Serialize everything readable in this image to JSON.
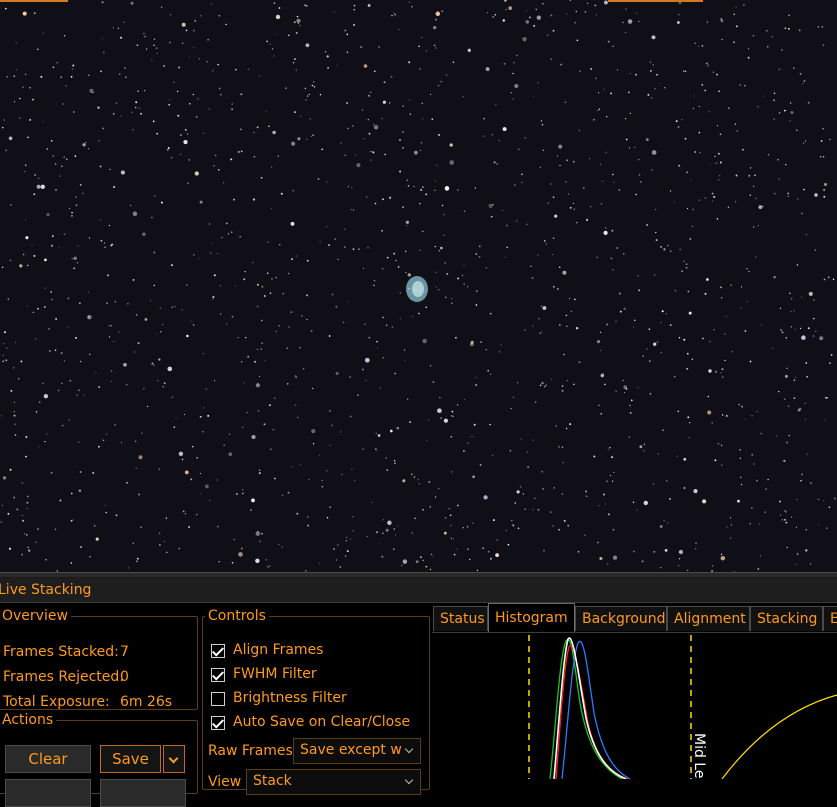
{
  "panel": {
    "title": "Live Stacking"
  },
  "overview": {
    "legend": "Overview",
    "frames_stacked_label": "Frames Stacked:",
    "frames_stacked_value": "7",
    "frames_rejected_label": "Frames Rejected:",
    "frames_rejected_value": "0",
    "total_exposure_label": "Total Exposure:",
    "total_exposure_value": "6m 26s"
  },
  "controls": {
    "legend": "Controls",
    "align_frames": {
      "label": "Align Frames",
      "checked": true
    },
    "fwhm_filter": {
      "label": "FWHM Filter",
      "checked": true
    },
    "brightness_filter": {
      "label": "Brightness Filter",
      "checked": false
    },
    "auto_save": {
      "label": "Auto Save on Clear/Close",
      "checked": true
    },
    "raw_frames_label": "Raw Frames",
    "raw_frames_value": "Save except w",
    "view_label": "View",
    "view_value": "Stack"
  },
  "actions": {
    "legend": "Actions",
    "clear_label": "Clear",
    "save_label": "Save"
  },
  "tabs": [
    {
      "label": "Status",
      "active": false
    },
    {
      "label": "Histogram",
      "active": true
    },
    {
      "label": "Background",
      "active": false
    },
    {
      "label": "Alignment",
      "active": false
    },
    {
      "label": "Stacking",
      "active": false
    },
    {
      "label": "Er",
      "active": false
    }
  ],
  "histogram": {
    "mid_level_label": "Mid Le",
    "colors": {
      "red": "#ff2020",
      "green": "#19c419",
      "blue": "#2a7bff",
      "luminance": "#ffffff",
      "markers": "#ffe000"
    }
  },
  "colors": {
    "accent": "#ff9a1a",
    "panel_bg": "#000000",
    "title_bar_bg": "#1e1e1e",
    "sky_bg": "#100e16"
  }
}
